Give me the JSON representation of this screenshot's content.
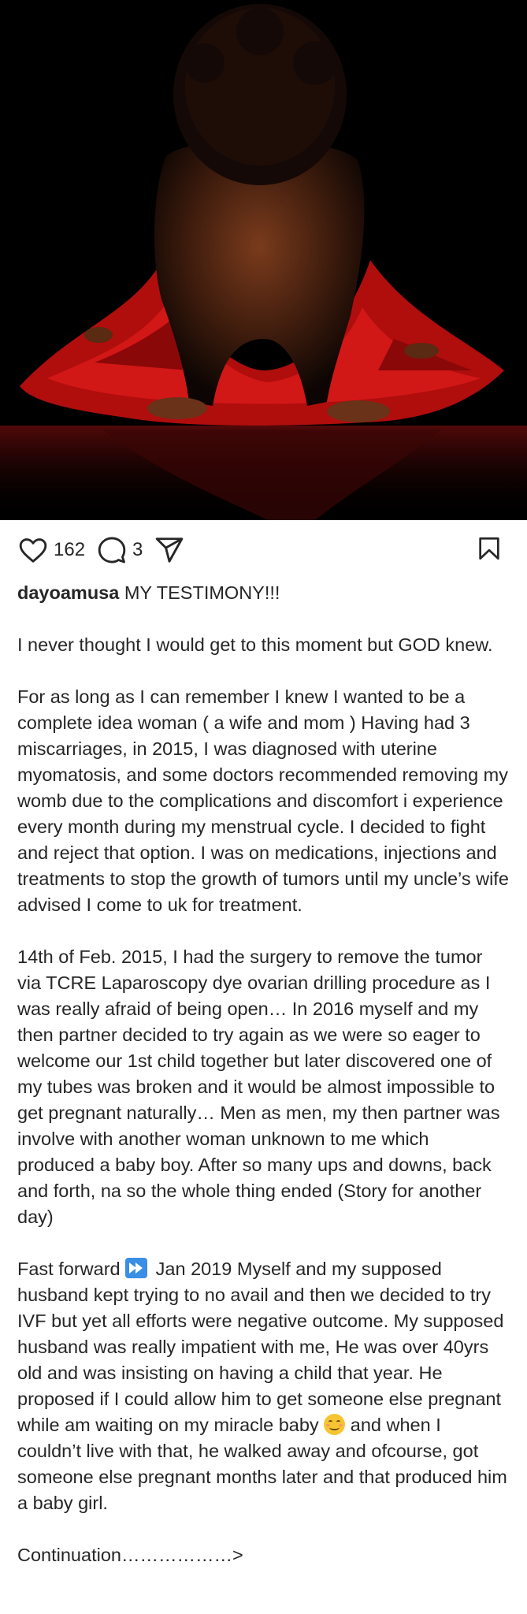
{
  "post": {
    "image_alt": "Woman kneeling on red fabric against black background",
    "likes": "162",
    "comments": "3"
  },
  "caption": {
    "username": "dayoamusa",
    "headline": "MY TESTIMONY!!!",
    "p1": "I never thought I would get to this moment but GOD knew.",
    "p2": "For as long as I can remember I knew I wanted to be a complete idea woman ( a wife and mom ) Having had 3 miscarriages, in 2015, I was diagnosed with uterine myomatosis, and some doctors recommended removing my womb due to the complications and discomfort i experience every month during my menstrual cycle. I decided to fight and reject that option. I was on medications, injections and treatments to stop the growth of tumors until my uncle’s wife advised I come to uk for treatment.",
    "p3": "14th of Feb. 2015, I had the surgery to remove the tumor via TCRE Laparoscopy dye ovarian drilling procedure as I was really afraid of being open… In 2016 myself and my then partner decided to try again as we were so eager to welcome our 1st child together but later discovered one of my tubes was broken and it would be almost impossible to get pregnant naturally… Men as men, my then partner was involve with another woman unknown to me which produced a baby boy. After so many ups and downs, back and forth, na so the whole thing ended (Story for another day)",
    "p4_before_emoji": "Fast forward",
    "p4_after_emoji1": " Jan 2019 Myself and my supposed husband kept trying to no avail and then we decided to try IVF but yet all efforts were negative outcome. My supposed husband was really impatient with me, He was over 40yrs old and was insisting on having a child that year. He proposed if I could allow him to get someone else pregnant while am waiting on my miracle baby",
    "p4_after_emoji2": " and when I couldn’t live with that, he walked away and ofcourse, got someone else pregnant months later and that produced him a baby girl.",
    "continuation": "Continuation………………>"
  },
  "icons": {
    "like": "heart-icon",
    "comment": "comment-icon",
    "share": "send-icon",
    "save": "bookmark-icon",
    "emoji1": "fast-forward-emoji",
    "emoji2": "smiling-face-emoji"
  }
}
